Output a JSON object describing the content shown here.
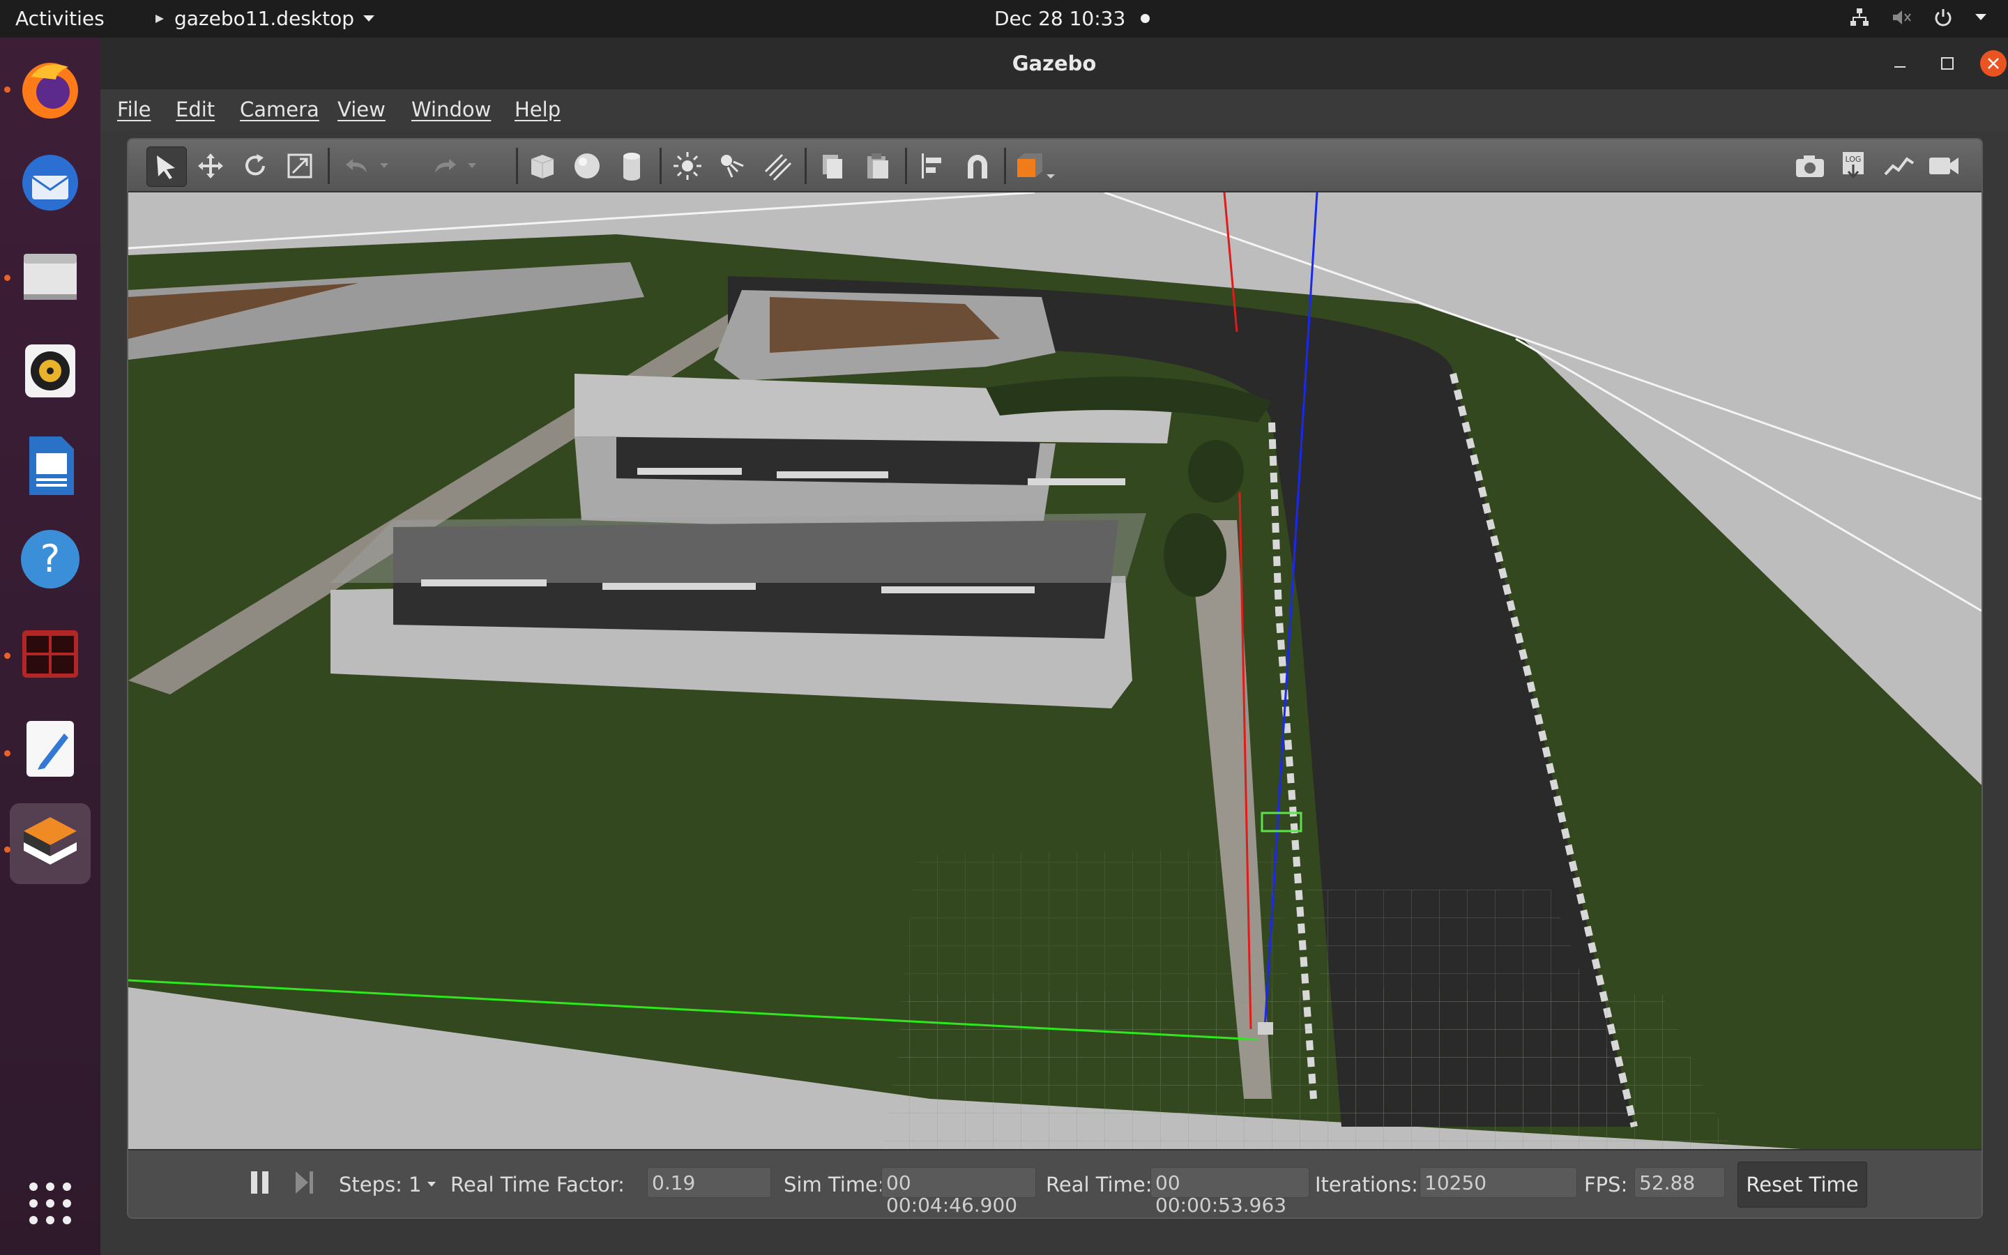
{
  "topbar": {
    "activities": "Activities",
    "app_menu": "gazebo11.desktop",
    "clock": "Dec 28  10:33"
  },
  "dock": {
    "items": [
      "firefox-icon",
      "thunderbird-icon",
      "files-icon",
      "rhythmbox-icon",
      "writer-icon",
      "help-icon",
      "terminal-app-icon",
      "text-editor-icon",
      "gazebo-icon"
    ]
  },
  "window": {
    "title": "Gazebo",
    "menus": [
      "File",
      "Edit",
      "Camera",
      "View",
      "Window",
      "Help"
    ]
  },
  "bottombar": {
    "steps_label": "Steps:",
    "steps_value": "1",
    "rtf_label": "Real Time Factor:",
    "rtf_value": "0.19",
    "sim_time_label": "Sim Time:",
    "sim_time_value": "00 00:04:46.900",
    "real_time_label": "Real Time:",
    "real_time_value": "00 00:00:53.963",
    "iterations_label": "Iterations:",
    "iterations_value": "10250",
    "fps_label": "FPS:",
    "fps_value": "52.88",
    "reset_label": "Reset Time"
  },
  "colors": {
    "accent_close": "#e95420",
    "dock_running": "#e8632a",
    "grass": "#2f4a1e",
    "road": "#2a2a2a"
  }
}
